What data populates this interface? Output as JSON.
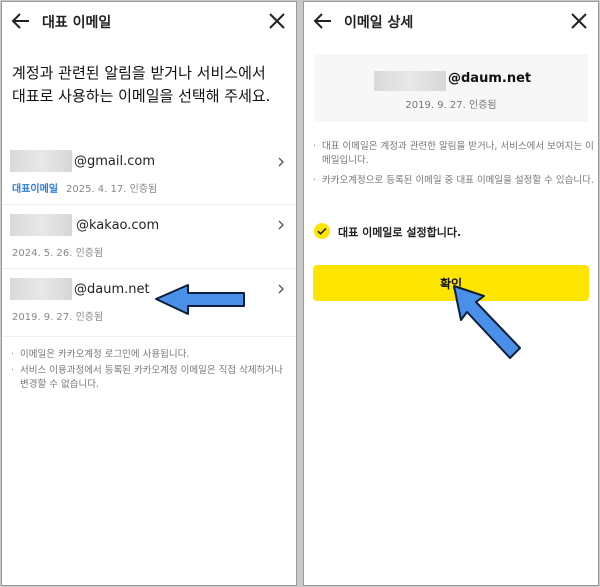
{
  "left": {
    "title": "대표 이메일",
    "intro": "계정과 관련된 알림을 받거나 서비스에서 대표로 사용하는 이메일을 선택해 주세요.",
    "emails": [
      {
        "domain": "@gmail.com",
        "badge": "대표이메일",
        "date": "2025. 4. 17. 인증됨"
      },
      {
        "domain": "@kakao.com",
        "badge": "",
        "date": "2024. 5. 26. 인증됨"
      },
      {
        "domain": "@daum.net",
        "badge": "",
        "date": "2019. 9. 27. 인증됨"
      }
    ],
    "notes": [
      "이메일은 카카오계정 로그인에 사용됩니다.",
      "서비스 이용과정에서 등록된 카카오계정 이메일은 직접 삭제하거나 변경할 수 없습니다."
    ]
  },
  "right": {
    "title": "이메일 상세",
    "email_domain": "@daum.net",
    "email_date": "2019. 9. 27. 인증됨",
    "notes": [
      "대표 이메일은 계정과 관련한 알림을 받거나, 서비스에서 보여지는 이메일입니다.",
      "카카오계정으로 등록된 이메일 중 대표 이메일을 설정할 수 있습니다."
    ],
    "checkbox_label": "대표 이메일로 설정합니다.",
    "confirm_label": "확인"
  },
  "colors": {
    "accent": "#fee500",
    "badge": "#2b7de0",
    "arrow": "#4a8fe8"
  }
}
